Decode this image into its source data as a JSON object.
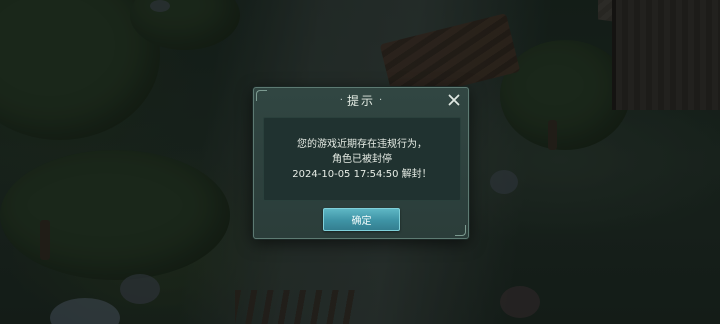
{
  "dialog": {
    "title": "提示",
    "title_deco_left": "·",
    "title_deco_right": "·",
    "close_glyph": "×",
    "message_lines": [
      "您的游戏近期存在违规行为，",
      "角色已被封停",
      "2024-10-05 17:54:50 解封！"
    ],
    "confirm_label": "确定"
  },
  "colors": {
    "panel_bg": "#314642",
    "panel_border": "#5d7a72",
    "content_bg": "#203230",
    "button_accent": "#4aa3b5",
    "text": "#e7ede6"
  },
  "icons": {
    "close": "close-icon"
  }
}
